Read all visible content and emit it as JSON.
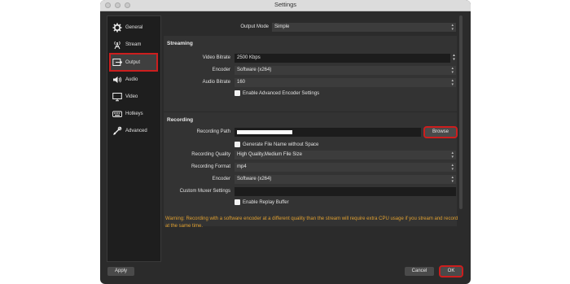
{
  "window": {
    "title": "Settings"
  },
  "sidebar": {
    "items": [
      {
        "label": "General",
        "icon": "gear-icon"
      },
      {
        "label": "Stream",
        "icon": "antenna-icon"
      },
      {
        "label": "Output",
        "icon": "output-icon"
      },
      {
        "label": "Audio",
        "icon": "speaker-icon"
      },
      {
        "label": "Video",
        "icon": "monitor-icon"
      },
      {
        "label": "Hotkeys",
        "icon": "keyboard-icon"
      },
      {
        "label": "Advanced",
        "icon": "tools-icon"
      }
    ],
    "selected": "Output"
  },
  "output_mode": {
    "label": "Output Mode",
    "value": "Simple"
  },
  "streaming": {
    "title": "Streaming",
    "video_bitrate": {
      "label": "Video Bitrate",
      "value": "2500 Kbps"
    },
    "encoder": {
      "label": "Encoder",
      "value": "Software (x264)"
    },
    "audio_bitrate": {
      "label": "Audio Bitrate",
      "value": "160"
    },
    "advanced_encoder": {
      "label": "Enable Advanced Encoder Settings"
    }
  },
  "recording": {
    "title": "Recording",
    "path": {
      "label": "Recording Path",
      "value": ""
    },
    "browse_label": "Browse",
    "generate_filename": {
      "label": "Generate File Name without Space"
    },
    "quality": {
      "label": "Recording Quality",
      "value": "High Quality,Medium File Size"
    },
    "format": {
      "label": "Recording Format",
      "value": "mp4"
    },
    "encoder": {
      "label": "Encoder",
      "value": "Software (x264)"
    },
    "custom_muxer": {
      "label": "Custom Muxer Settings",
      "value": ""
    },
    "replay_buffer": {
      "label": "Enable Replay Buffer"
    }
  },
  "warning": "Warning: Recording with a software encoder at a different quality than the stream will require extra CPU usage if you stream and record at the same time.",
  "footer": {
    "apply_label": "Apply",
    "cancel_label": "Cancel",
    "ok_label": "OK"
  },
  "colors": {
    "highlight": "#cc1e1e",
    "warning_text": "#e0a030",
    "window_bg": "#2b2b2b"
  }
}
